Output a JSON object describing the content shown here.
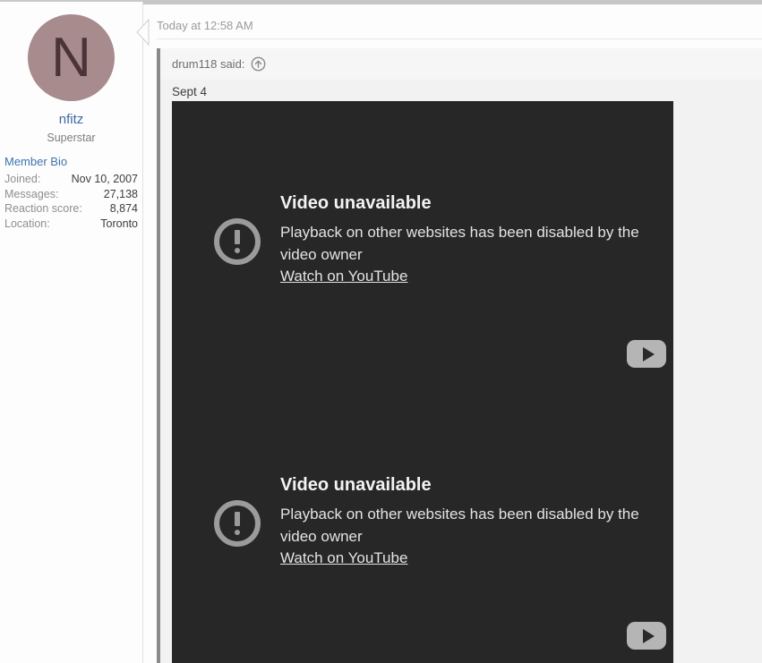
{
  "user": {
    "avatar_letter": "N",
    "name": "nfitz",
    "title": "Superstar",
    "member_bio_label": "Member Bio",
    "stats": [
      {
        "label": "Joined:",
        "value": "Nov 10, 2007"
      },
      {
        "label": "Messages:",
        "value": "27,138"
      },
      {
        "label": "Reaction score:",
        "value": "8,874"
      },
      {
        "label": "Location:",
        "value": "Toronto"
      }
    ]
  },
  "post": {
    "timestamp": "Today at 12:58 AM",
    "quote": {
      "attribution": "drum118 said:",
      "jump_icon": "arrow-up-circle-icon",
      "text": "Sept 4"
    }
  },
  "videos": [
    {
      "title": "Video unavailable",
      "message": "Playback on other websites has been disabled by the video owner",
      "link_label": "Watch on YouTube"
    },
    {
      "title": "Video unavailable",
      "message": "Playback on other websites has been disabled by the video owner",
      "link_label": "Watch on YouTube"
    }
  ],
  "colors": {
    "avatar_bg": "#a78b8d",
    "avatar_letter": "#4b3438",
    "link_blue": "#3d68a8",
    "video_bg": "#272727",
    "quote_bg": "#f2f2f2",
    "quote_border": "#8a8a8a"
  }
}
